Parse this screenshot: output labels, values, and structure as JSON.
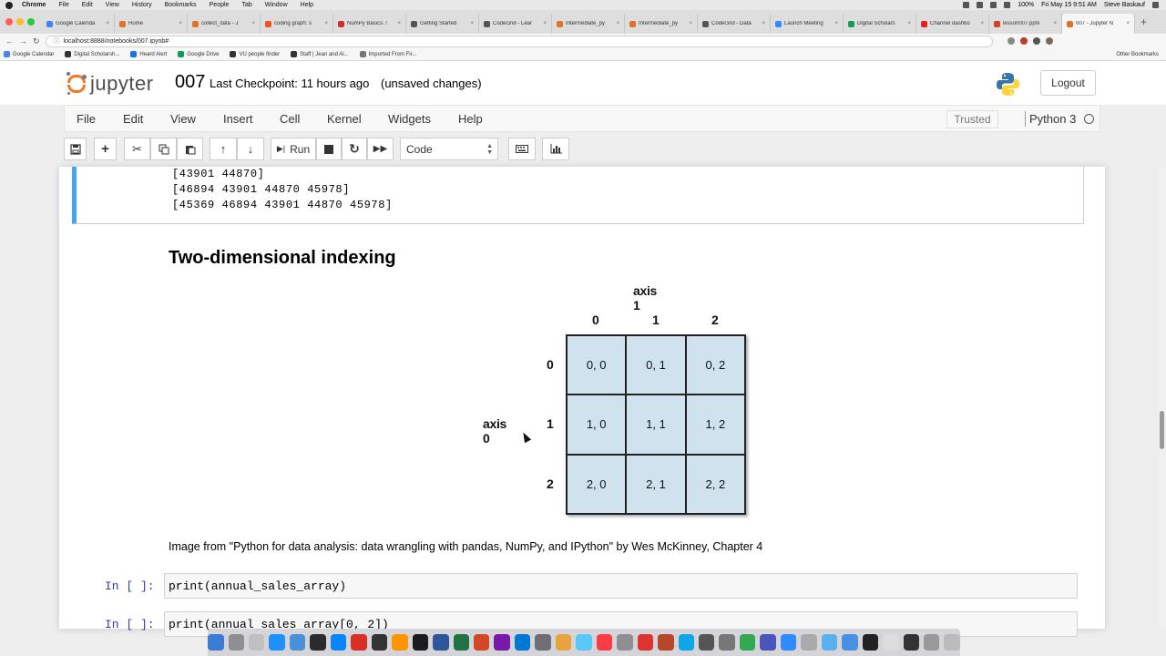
{
  "mac_menubar": {
    "app": "Chrome",
    "items": [
      "File",
      "Edit",
      "View",
      "History",
      "Bookmarks",
      "People",
      "Tab",
      "Window",
      "Help"
    ],
    "battery": "100%",
    "clock": "Fri May 15  9:51 AM",
    "user": "Steve Baskauf"
  },
  "browser": {
    "tabs": [
      {
        "title": "Google Calenda",
        "color": "#4285f4"
      },
      {
        "title": "Home",
        "color": "#e37222"
      },
      {
        "title": "collect_data - J",
        "color": "#e37222"
      },
      {
        "title": "coding graph: s",
        "color": "#f4511e"
      },
      {
        "title": "NumPy Basics: /",
        "color": "#d32f2f"
      },
      {
        "title": "Getting Started",
        "color": "#555555"
      },
      {
        "title": "CodeGrid - Lear",
        "color": "#555555"
      },
      {
        "title": "Intermediate_py",
        "color": "#e37222"
      },
      {
        "title": "Intermediate_py",
        "color": "#e37222"
      },
      {
        "title": "CodeGrid - Data",
        "color": "#555555"
      },
      {
        "title": "Launch Meeting",
        "color": "#2d8cff"
      },
      {
        "title": "Digital Scholars",
        "color": "#0f9d58"
      },
      {
        "title": "Channel dashbo",
        "color": "#e62117"
      },
      {
        "title": "lesson007.pptx",
        "color": "#d04423"
      },
      {
        "title": "007 - Jupyter N",
        "color": "#e37222",
        "active": true
      }
    ],
    "url": "localhost:8888/notebooks/007.ipynb#",
    "bookmarks": [
      {
        "label": "Google Calendar",
        "color": "#4285f4"
      },
      {
        "label": "Digital Scholarsh...",
        "color": "#333333"
      },
      {
        "label": "Heard Alert",
        "color": "#1a73e8"
      },
      {
        "label": "Google Drive",
        "color": "#0f9d58"
      },
      {
        "label": "VU people finder",
        "color": "#333333"
      },
      {
        "label": "Staff | Jean and Al...",
        "color": "#333333"
      },
      {
        "label": "Imported From Fir...",
        "color": "#777777"
      }
    ],
    "other_bookmarks": "Other Bookmarks"
  },
  "header": {
    "logo_text": "jupyter",
    "notebook_name": "007",
    "checkpoint": "Last Checkpoint: 11 hours ago",
    "status": "(unsaved changes)",
    "logout": "Logout"
  },
  "menubar": {
    "items": [
      "File",
      "Edit",
      "View",
      "Insert",
      "Cell",
      "Kernel",
      "Widgets",
      "Help"
    ],
    "trusted": "Trusted",
    "kernel": "Python 3"
  },
  "toolbar": {
    "run_label": "Run",
    "cell_type": "Code"
  },
  "notebook": {
    "output_lines": [
      "[43901 44870]",
      "[46894 43901 44870 45978]",
      "[45369 46894 43901 44870 45978]"
    ],
    "heading": "Two-dimensional indexing",
    "figure": {
      "axis1_label": "axis 1",
      "axis0_label": "axis 0",
      "col_indices": [
        "0",
        "1",
        "2"
      ],
      "row_indices": [
        "0",
        "1",
        "2"
      ],
      "cells": [
        "0, 0",
        "0, 1",
        "0, 2",
        "1, 0",
        "1, 1",
        "1, 2",
        "2, 0",
        "2, 1",
        "2, 2"
      ],
      "cell_color": "#cfe2ee"
    },
    "caption": "Image from \"Python for data analysis: data wrangling with pandas, NumPy, and IPython\" by Wes McKinney, Chapter 4",
    "code_cells": [
      {
        "prompt": "In [ ]:",
        "code": "print(annual_sales_array)"
      },
      {
        "prompt": "In [ ]:",
        "code": "print(annual_sales_array[0, 2])"
      }
    ]
  },
  "colors": {
    "jupyter_orange": "#f37726",
    "selected_cell_border": "#42a5f5",
    "prompt_blue": "#303f9f"
  }
}
